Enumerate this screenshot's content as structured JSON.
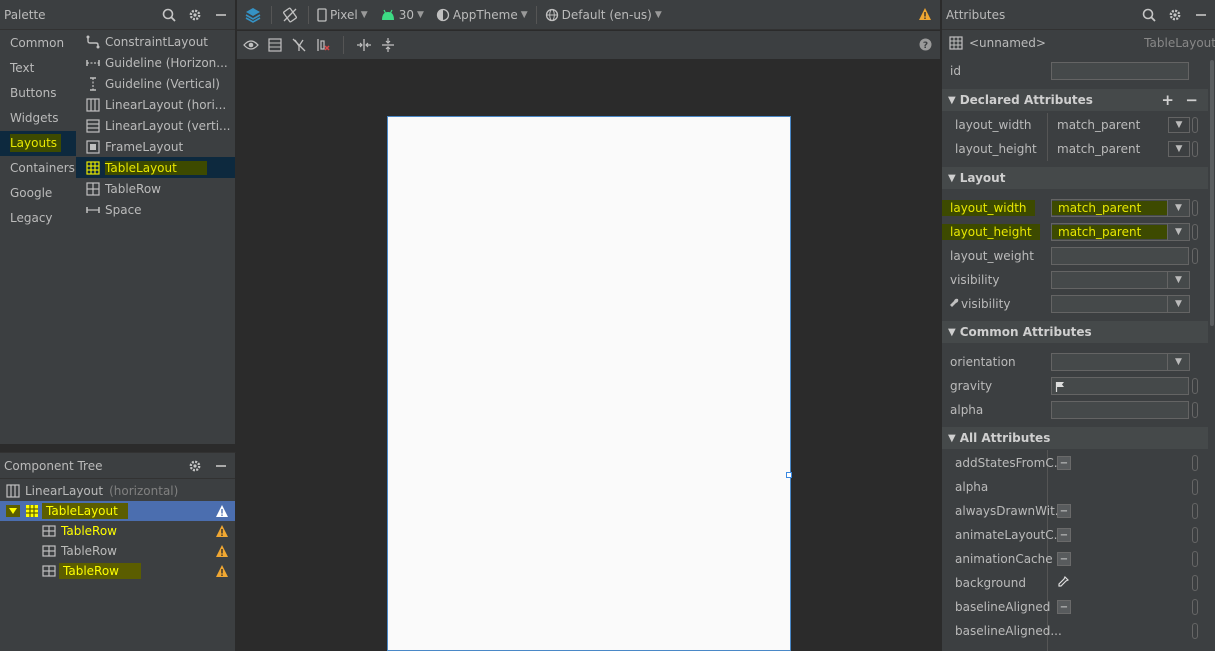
{
  "palette": {
    "title": "Palette",
    "categories": [
      "Common",
      "Text",
      "Buttons",
      "Widgets",
      "Layouts",
      "Containers",
      "Google",
      "Legacy"
    ],
    "selected_category": "Layouts",
    "items": [
      {
        "label": "ConstraintLayout",
        "icon": "constraint-layout-icon"
      },
      {
        "label": "Guideline (Horizon...",
        "icon": "guideline-horizontal-icon"
      },
      {
        "label": "Guideline (Vertical)",
        "icon": "guideline-vertical-icon"
      },
      {
        "label": "LinearLayout (hori...",
        "icon": "linearlayout-horizontal-icon"
      },
      {
        "label": "LinearLayout (verti...",
        "icon": "linearlayout-vertical-icon"
      },
      {
        "label": "FrameLayout",
        "icon": "framelayout-icon"
      },
      {
        "label": "TableLayout",
        "icon": "tablelayout-icon"
      },
      {
        "label": "TableRow",
        "icon": "tablerow-icon"
      },
      {
        "label": "Space",
        "icon": "space-icon"
      }
    ],
    "selected_item": "TableLayout"
  },
  "tree": {
    "title": "Component Tree",
    "root": {
      "label": "LinearLayout",
      "hint": "(horizontal)"
    },
    "rows": [
      {
        "label": "TableLayout",
        "warning": true
      },
      {
        "label": "TableRow",
        "warning": true
      },
      {
        "label": "TableRow",
        "warning": true
      },
      {
        "label": "TableRow",
        "warning": true
      }
    ]
  },
  "toolbar": {
    "device": "Pixel",
    "api": "30",
    "theme": "AppTheme",
    "locale": "Default (en-us)"
  },
  "attributes": {
    "title": "Attributes",
    "component": "<unnamed>",
    "component_type": "TableLayout",
    "id_label": "id",
    "sections": {
      "declared": "Declared Attributes",
      "layout": "Layout",
      "common": "Common Attributes",
      "all": "All Attributes"
    },
    "declared": [
      {
        "name": "layout_width",
        "value": "match_parent"
      },
      {
        "name": "layout_height",
        "value": "match_parent"
      }
    ],
    "layout": [
      {
        "name": "layout_width",
        "value": "match_parent"
      },
      {
        "name": "layout_height",
        "value": "match_parent"
      },
      {
        "name": "layout_weight",
        "value": ""
      },
      {
        "name": "visibility",
        "value": ""
      },
      {
        "name": "visibility",
        "value": ""
      }
    ],
    "common": [
      {
        "name": "orientation",
        "value": ""
      },
      {
        "name": "gravity",
        "value": ""
      },
      {
        "name": "alpha",
        "value": ""
      }
    ],
    "all": [
      "addStatesFromC...",
      "alpha",
      "alwaysDrawnWit...",
      "animateLayoutC...",
      "animationCache",
      "background",
      "baselineAligned",
      "baselineAligned..."
    ]
  },
  "colors": {
    "highlight": "#e8e800",
    "selection": "#4b6eaf",
    "warning": "#f0a732",
    "android_green": "#3ddc84"
  }
}
